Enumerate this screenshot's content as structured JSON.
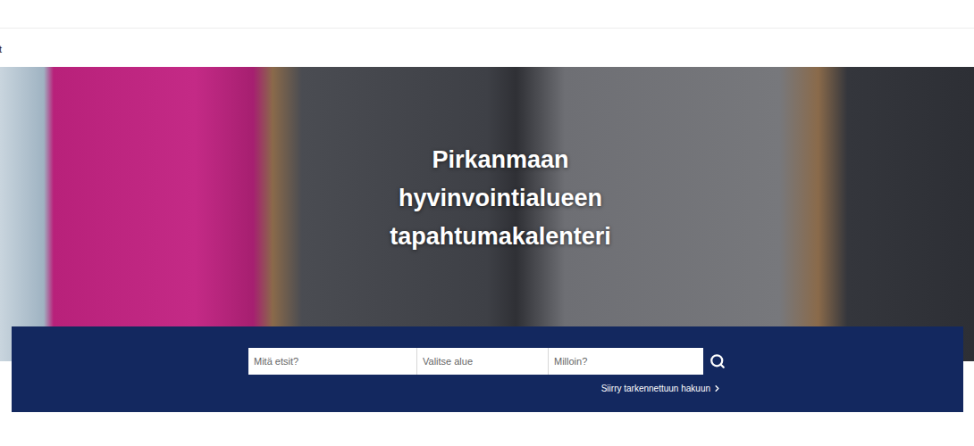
{
  "header": {
    "cut_text": "t"
  },
  "hero": {
    "title_lines": [
      "Pirkanmaan",
      "hyvinvointialueen",
      "tapahtumakalenteri"
    ]
  },
  "search": {
    "fields": [
      {
        "placeholder": "Mitä etsit?"
      },
      {
        "placeholder": "Valitse alue"
      },
      {
        "placeholder": "Milloin?"
      }
    ],
    "advanced_link": {
      "label": "Siirry tarkennettuun hakuun"
    }
  }
}
